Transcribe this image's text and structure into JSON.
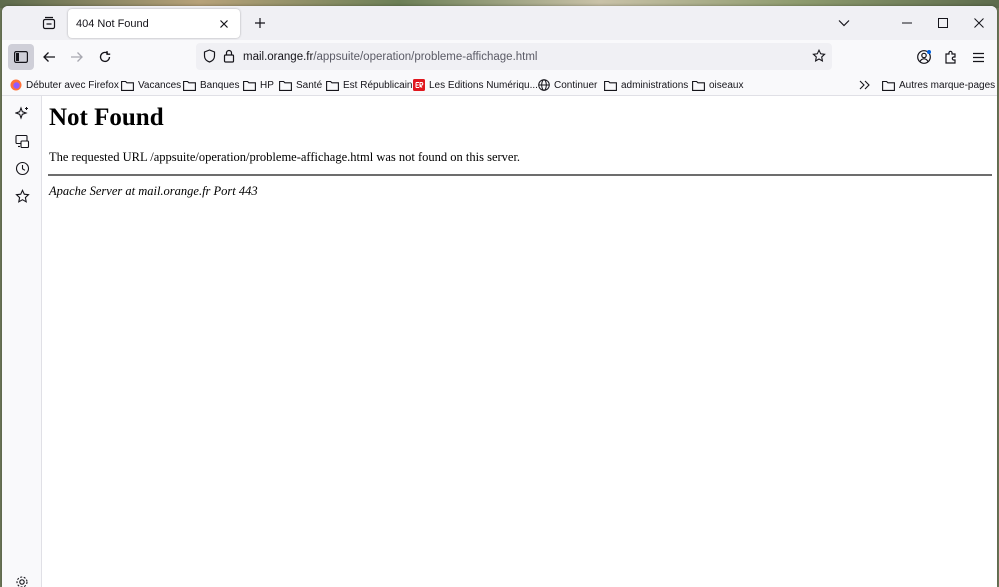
{
  "tab": {
    "title": "404 Not Found"
  },
  "urlbar": {
    "host": "mail.orange.fr",
    "path": "/appsuite/operation/probleme-affichage.html"
  },
  "bookmarks": {
    "items": [
      {
        "label": "Débuter avec Firefox",
        "icon": "firefox-icon"
      },
      {
        "label": "Vacances",
        "icon": "folder-icon"
      },
      {
        "label": "Banques",
        "icon": "folder-icon"
      },
      {
        "label": "HP",
        "icon": "folder-icon"
      },
      {
        "label": "Santé",
        "icon": "folder-icon"
      },
      {
        "label": "Est Républicain",
        "icon": "folder-icon"
      },
      {
        "label": "Les Editions Numériqu...",
        "icon": "er-site-icon"
      },
      {
        "label": "Continuer",
        "icon": "globe-icon"
      },
      {
        "label": "administrations",
        "icon": "folder-icon"
      },
      {
        "label": "oiseaux",
        "icon": "folder-icon"
      }
    ],
    "other_label": "Autres marque-pages"
  },
  "page": {
    "heading": "Not Found",
    "message": "The requested URL /appsuite/operation/probleme-affichage.html was not found on this server.",
    "server_signature": "Apache Server at mail.orange.fr Port 443"
  },
  "colors": {
    "chrome": "#f0f0f4",
    "toolbar": "#f9f9fb",
    "accent": "#0061e0",
    "er_badge": "#e0161d"
  }
}
